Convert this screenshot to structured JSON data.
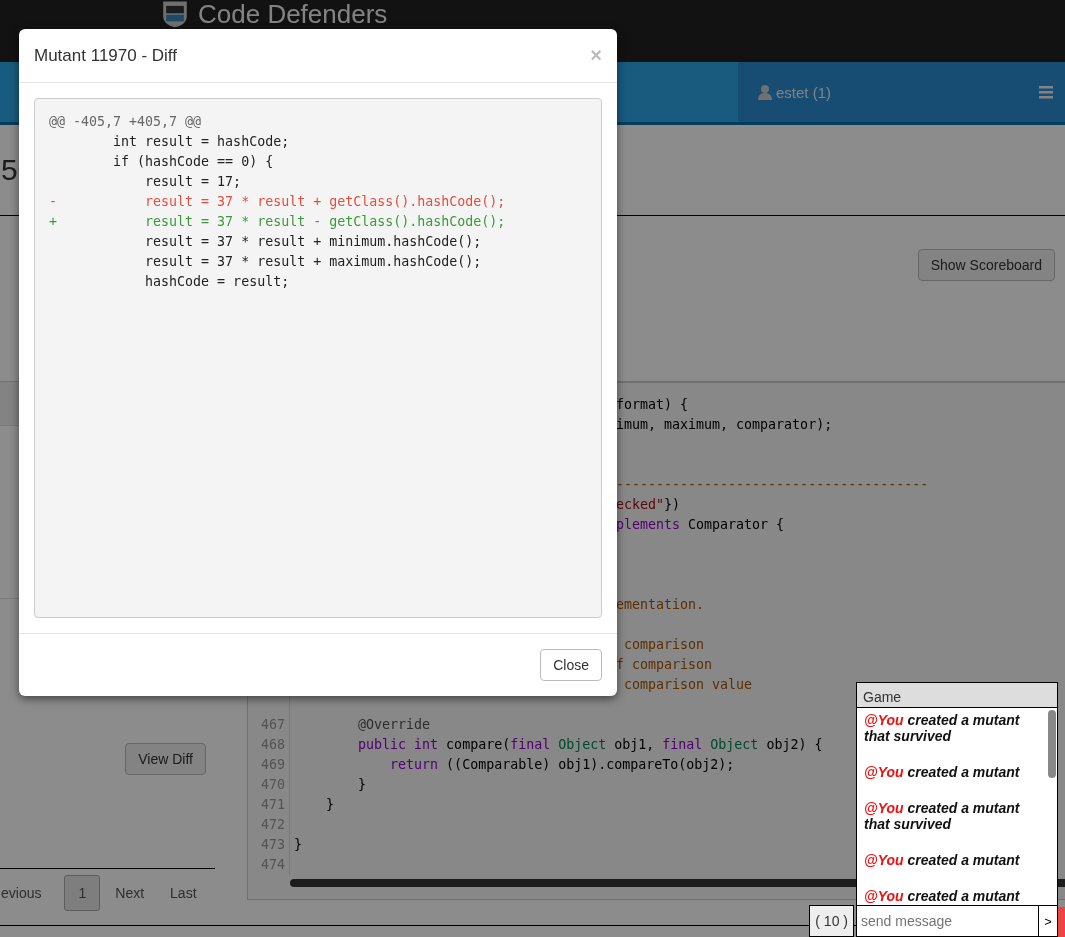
{
  "header": {
    "brand": "Code Defenders"
  },
  "navbar": {
    "user": "estet (1)"
  },
  "page": {
    "title_fragment": "5",
    "scoreboard_button": "Show Scoreboard"
  },
  "mutants_panel": {
    "view_diff_button": "View Diff",
    "pagination": [
      {
        "label": "evious",
        "selected": false
      },
      {
        "label": "1",
        "selected": true
      },
      {
        "label": "Next",
        "selected": false
      },
      {
        "label": "Last",
        "selected": false
      }
    ]
  },
  "code_panel": {
    "lines": [
      {
        "kind": "fragment",
        "tokens": [
          {
            "t": "format) {",
            "kind": "plain"
          }
        ]
      },
      {
        "kind": "fragment",
        "tokens": [
          {
            "t": "imum, maximum, comparator);",
            "kind": "plain"
          }
        ]
      },
      {
        "kind": "blank"
      },
      {
        "kind": "blank"
      },
      {
        "kind": "fragment",
        "tokens": [
          {
            "t": "---------------------------------------",
            "kind": "comment"
          }
        ]
      },
      {
        "kind": "fragment",
        "tokens": [
          {
            "t": "ecked\"",
            "kind": "string"
          },
          {
            "t": "})",
            "kind": "plain"
          }
        ]
      },
      {
        "kind": "fragment",
        "tokens": [
          {
            "t": "plements",
            "kind": "keyword"
          },
          {
            "t": " Comparator {",
            "kind": "plain"
          }
        ]
      },
      {
        "kind": "blank"
      },
      {
        "kind": "blank"
      },
      {
        "kind": "blank"
      },
      {
        "kind": "fragment",
        "tokens": [
          {
            "t": "ementation.",
            "kind": "comment"
          }
        ]
      },
      {
        "kind": "blank"
      },
      {
        "kind": "fragment",
        "tokens": [
          {
            "t": " comparison",
            "kind": "comment"
          }
        ]
      },
      {
        "kind": "fragment",
        "tokens": [
          {
            "t": "f comparison",
            "kind": "comment"
          }
        ]
      },
      {
        "kind": "fragment",
        "tokens": [
          {
            "t": " comparison value",
            "kind": "comment"
          }
        ]
      },
      {
        "kind": "blank"
      },
      {
        "kind": "full",
        "number": "467",
        "tokens": [
          {
            "t": "        @Override",
            "kind": "meta"
          }
        ]
      },
      {
        "kind": "full",
        "number": "468",
        "tokens": [
          {
            "t": "        public",
            "kind": "keyword"
          },
          {
            "t": " int",
            "kind": "keyword"
          },
          {
            "t": " compare(",
            "kind": "plain"
          },
          {
            "t": "final",
            "kind": "keyword"
          },
          {
            "t": " Object",
            "kind": "type"
          },
          {
            "t": " obj1, ",
            "kind": "plain"
          },
          {
            "t": "final",
            "kind": "keyword"
          },
          {
            "t": " Object",
            "kind": "type"
          },
          {
            "t": " obj2) {",
            "kind": "plain"
          }
        ]
      },
      {
        "kind": "full",
        "number": "469",
        "tokens": [
          {
            "t": "            return",
            "kind": "keyword"
          },
          {
            "t": " ((Comparable) obj1).compareTo(obj2);",
            "kind": "plain"
          }
        ]
      },
      {
        "kind": "full",
        "number": "470",
        "tokens": [
          {
            "t": "        }",
            "kind": "plain"
          }
        ]
      },
      {
        "kind": "full",
        "number": "471",
        "tokens": [
          {
            "t": "    }",
            "kind": "plain"
          }
        ]
      },
      {
        "kind": "full",
        "number": "472"
      },
      {
        "kind": "full",
        "number": "473",
        "tokens": [
          {
            "t": "}",
            "kind": "plain"
          }
        ]
      },
      {
        "kind": "full",
        "number": "474"
      }
    ]
  },
  "modal": {
    "title": "Mutant 11970 - Diff",
    "close_icon": "×",
    "close_button": "Close",
    "diff": [
      {
        "kind": "header",
        "text": "@@ -405,7 +405,7 @@"
      },
      {
        "kind": "context",
        "text": "        int result = hashCode;"
      },
      {
        "kind": "context",
        "text": "        if (hashCode == 0) {"
      },
      {
        "kind": "context",
        "text": "            result = 17;"
      },
      {
        "kind": "removed",
        "text": "-           result = 37 * result + getClass().hashCode();"
      },
      {
        "kind": "added",
        "text": "+           result = 37 * result - getClass().hashCode();"
      },
      {
        "kind": "context",
        "text": "            result = 37 * result + minimum.hashCode();"
      },
      {
        "kind": "context",
        "text": "            result = 37 * result + maximum.hashCode();"
      },
      {
        "kind": "context",
        "text": "            hashCode = result;"
      }
    ]
  },
  "chat": {
    "channel": "Game",
    "count": "( 10 )",
    "placeholder": "send message",
    "send": ">",
    "messages": [
      {
        "user": "@You",
        "text": "created a mutant that survived"
      },
      {
        "user": "@You",
        "text": "created a mutant"
      },
      {
        "user": "@You",
        "text": "created a mutant that survived"
      },
      {
        "user": "@You",
        "text": "created a mutant"
      },
      {
        "user": "@You",
        "text": "created a mutant"
      }
    ]
  }
}
